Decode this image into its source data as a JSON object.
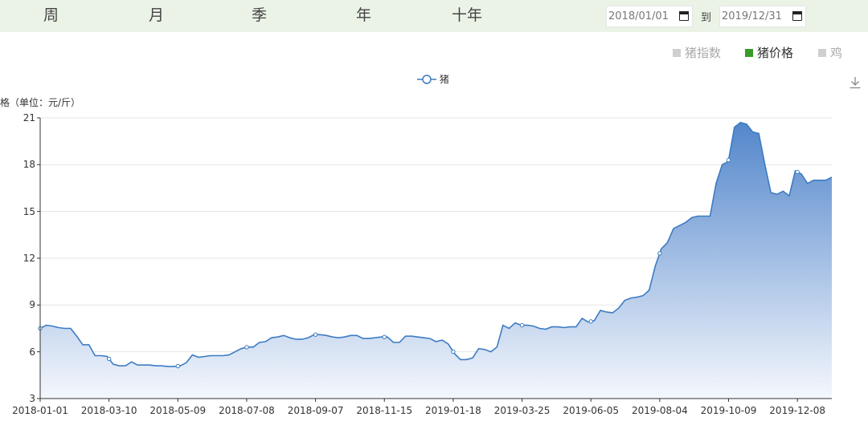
{
  "tabs": [
    {
      "label": "周"
    },
    {
      "label": "月"
    },
    {
      "label": "季"
    },
    {
      "label": "年"
    },
    {
      "label": "十年"
    }
  ],
  "date_range": {
    "start": "2018/01/01",
    "separator": "到",
    "end": "2019/12/31"
  },
  "toggles": [
    {
      "label": "猪指数",
      "active": false
    },
    {
      "label": "猪价格",
      "active": true
    },
    {
      "label": "鸡",
      "active": false
    }
  ],
  "colors": {
    "line": "#3d7cc2",
    "area_top": "#4a80c8",
    "area_bottom": "#f4f7fd",
    "active_toggle": "#3a9a2a",
    "topbar": "#ebf3e7"
  },
  "chart_data": {
    "type": "area",
    "legend": [
      "猪"
    ],
    "ylabel": "价格（单位：元/斤）",
    "ylim": [
      3,
      21
    ],
    "yticks": [
      "21",
      "18",
      "15",
      "12",
      "9",
      "6",
      "3"
    ],
    "xlabels": [
      "2018-01-01",
      "2018-03-10",
      "2018-05-09",
      "2018-07-08",
      "2018-09-07",
      "2018-11-15",
      "2019-01-18",
      "2019-03-25",
      "2019-06-05",
      "2019-08-04",
      "2019-10-09",
      "2019-12-08"
    ],
    "grid": true,
    "series": [
      {
        "name": "猪",
        "values": [
          7.5,
          7.7,
          7.65,
          7.55,
          7.5,
          7.5,
          7.0,
          6.45,
          6.45,
          5.75,
          5.75,
          5.7,
          5.2,
          5.1,
          5.1,
          5.35,
          5.15,
          5.15,
          5.15,
          5.1,
          5.1,
          5.05,
          5.05,
          5.1,
          5.3,
          5.8,
          5.65,
          5.7,
          5.75,
          5.75,
          5.75,
          5.8,
          6.0,
          6.2,
          6.3,
          6.3,
          6.6,
          6.65,
          6.9,
          6.95,
          7.05,
          6.9,
          6.8,
          6.8,
          6.9,
          7.1,
          7.1,
          7.05,
          6.95,
          6.9,
          6.95,
          7.05,
          7.05,
          6.85,
          6.85,
          6.9,
          6.95,
          6.95,
          6.6,
          6.6,
          7.0,
          7.0,
          6.95,
          6.9,
          6.85,
          6.65,
          6.75,
          6.5,
          5.9,
          5.5,
          5.5,
          5.6,
          6.2,
          6.15,
          6.0,
          6.3,
          7.7,
          7.5,
          7.85,
          7.7,
          7.7,
          7.65,
          7.5,
          7.45,
          7.6,
          7.6,
          7.55,
          7.6,
          7.6,
          8.15,
          7.9,
          8.0,
          8.65,
          8.55,
          8.5,
          8.8,
          9.3,
          9.45,
          9.5,
          9.6,
          9.95,
          11.5,
          12.6,
          13.0,
          13.9,
          14.1,
          14.3,
          14.6,
          14.7,
          14.7,
          14.7,
          16.8,
          18.0,
          18.2,
          20.4,
          20.7,
          20.6,
          20.1,
          20.0,
          18.0,
          16.2,
          16.1,
          16.3,
          16.0,
          17.6,
          17.4,
          16.8,
          17.0,
          17.0,
          17.0,
          17.2
        ]
      }
    ]
  }
}
